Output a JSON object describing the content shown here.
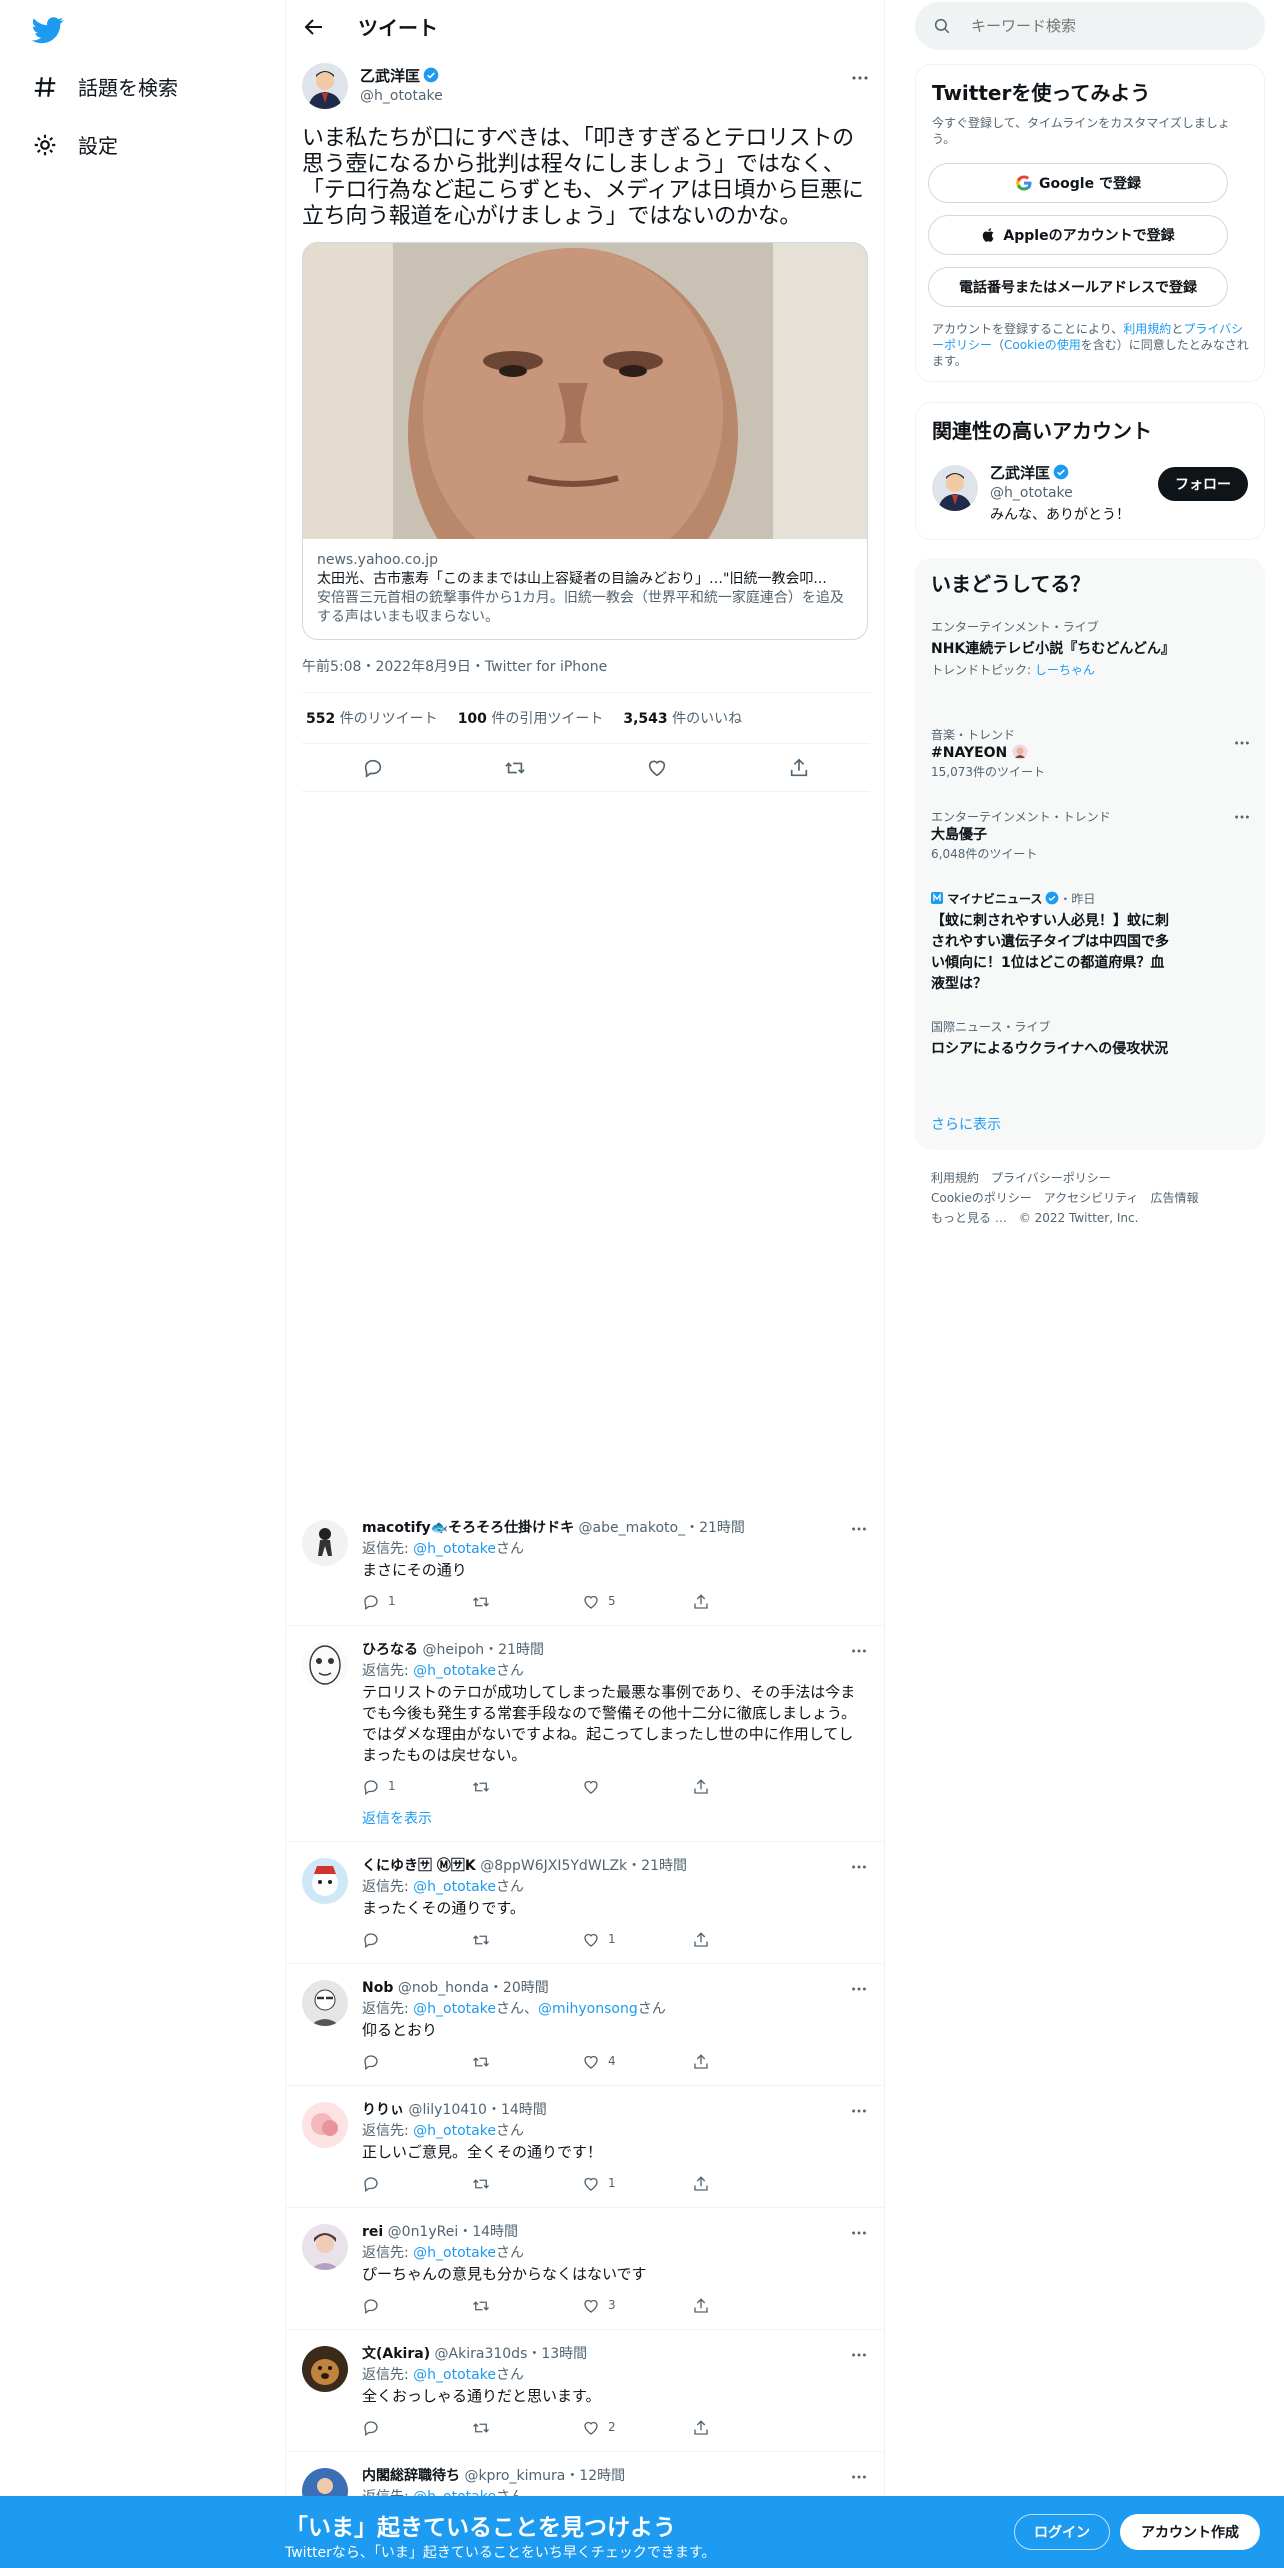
{
  "nav": {
    "explore": "話題を検索",
    "settings": "設定"
  },
  "header": {
    "title": "ツイート"
  },
  "tweet": {
    "display_name": "乙武洋匡",
    "handle": "@h_ototake",
    "text": "いま私たちが口にすべきは、「叩きすぎるとテロリストの思う壺になるから批判は程々にしましょう」ではなく、「テロ行為など起こらずとも、メディアは日頃から巨悪に立ち向う報道を心がけましょう」ではないのかな。",
    "card": {
      "domain": "news.yahoo.co.jp",
      "title": "太田光、古市憲寿「このままでは山上容疑者の目論みどおり」…\"旧統一教会叩...",
      "description": "安倍晋三元首相の銃撃事件から1カ月。旧統一教会（世界平和統一家庭連合）を追及する声はいまも収まらない。"
    },
    "meta": "午前5:08・2022年8月9日・Twitter for iPhone",
    "retweets": "552",
    "retweets_label": "件のリツイート",
    "quotes": "100",
    "quotes_label": "件の引用ツイート",
    "likes": "3,543",
    "likes_label": "件のいいね"
  },
  "replies": [
    {
      "name": "macotify🐟そろそろ仕掛けドキ",
      "handle": "@abe_makoto_",
      "time": "・21時間",
      "reply_to_prefix": "返信先: ",
      "reply_to": "@h_ototake",
      "reply_to_suffix": "さん",
      "text": "まさにその通り",
      "replies_count": "1",
      "likes_count": "5"
    },
    {
      "name": "ひろなる",
      "handle": "@heipoh",
      "time": "・21時間",
      "reply_to_prefix": "返信先: ",
      "reply_to": "@h_ototake",
      "reply_to_suffix": "さん",
      "text": "テロリストのテロが成功してしまった最悪な事例であり、その手法は今までも今後も発生する常套手段なので警備その他十二分に徹底しましょう。ではダメな理由がないですよね。起こってしまったし世の中に作用してしまったものは戻せない。",
      "replies_count": "1",
      "likes_count": "",
      "show_replies": "返信を表示"
    },
    {
      "name": "くにゆき🈂 Ⓜ🈂K",
      "handle": "@8ppW6JXI5YdWLZk",
      "time": "・21時間",
      "reply_to_prefix": "返信先: ",
      "reply_to": "@h_ototake",
      "reply_to_suffix": "さん",
      "text": "まったくその通りです。",
      "replies_count": "",
      "likes_count": "1"
    },
    {
      "name": "Nob",
      "handle": "@nob_honda",
      "time": "・20時間",
      "reply_to_prefix": "返信先: ",
      "reply_to": "@h_ototake",
      "reply_to_mid": "さん、",
      "reply_to2": "@mihyonsong",
      "reply_to_suffix": "さん",
      "text": "仰るとおり",
      "replies_count": "",
      "likes_count": "4"
    },
    {
      "name": "りりぃ",
      "handle": "@lily10410",
      "time": "・14時間",
      "reply_to_prefix": "返信先: ",
      "reply_to": "@h_ototake",
      "reply_to_suffix": "さん",
      "text": "正しいご意見。全くその通りです！",
      "replies_count": "",
      "likes_count": "1"
    },
    {
      "name": "rei",
      "handle": "@0n1yRei",
      "time": "・14時間",
      "reply_to_prefix": "返信先: ",
      "reply_to": "@h_ototake",
      "reply_to_suffix": "さん",
      "text": "ぴーちゃんの意見も分からなくはないです",
      "replies_count": "",
      "likes_count": "3"
    },
    {
      "name": "文(Akira)",
      "handle": "@Akira310ds",
      "time": "・13時間",
      "reply_to_prefix": "返信先: ",
      "reply_to": "@h_ototake",
      "reply_to_suffix": "さん",
      "text": "全くおっしゃる通りだと思います。",
      "replies_count": "",
      "likes_count": "2"
    },
    {
      "name": "内閣総辞職待ち",
      "handle": "@kpro_kimura",
      "time": "・12時間",
      "reply_to_prefix": "返信先: ",
      "reply_to": "@h_ototake",
      "reply_to_suffix": "さん",
      "text": "",
      "replies_count": "",
      "likes_count": ""
    }
  ],
  "search": {
    "placeholder": "キーワード検索"
  },
  "signup": {
    "title": "Twitterを使ってみよう",
    "subtitle": "今すぐ登録して、タイムラインをカスタマイズしましょう。",
    "google": "Google で登録",
    "apple": "Appleのアカウントで登録",
    "phone": "電話番号またはメールアドレスで登録",
    "legal_prefix": "アカウントを登録することにより、",
    "legal_terms": "利用規約",
    "legal_and": "と",
    "legal_privacy": "プライバシーポリシー",
    "legal_open": "（",
    "legal_cookie": "Cookieの使用",
    "legal_suffix": "を含む）に同意したとみなされます。"
  },
  "related": {
    "title": "関連性の高いアカウント",
    "name": "乙武洋匡",
    "handle": "@h_ototake",
    "bio": "みんな、ありがとう！",
    "follow": "フォロー"
  },
  "trends": {
    "title": "いまどうしてる？",
    "items": [
      {
        "category": "エンターテインメント・ライブ",
        "title": "NHK連続テレビ小説『ちむどんどん』",
        "sub_prefix": "トレンドトピック: ",
        "sub_link": "しーちゃん"
      },
      {
        "category": "音楽・トレンド",
        "title": "#NAYEON",
        "sub": "15,073件のツイート"
      },
      {
        "category": "エンターテインメント・トレンド",
        "title": "大島優子",
        "sub": "6,048件のツイート"
      },
      {
        "category": "マイナビニュース",
        "category_time": "・昨日",
        "title": "【蚊に刺されやすい人必見！】蚊に刺されやすい遺伝子タイプは中四国で多い傾向に！1位はどこの都道府県？血液型は？"
      },
      {
        "category": "国際ニュース・ライブ",
        "title": "ロシアによるウクライナへの侵攻状況"
      }
    ],
    "show_more": "さらに表示"
  },
  "footer": {
    "terms": "利用規約",
    "privacy": "プライバシーポリシー",
    "cookie": "Cookieのポリシー",
    "accessibility": "アクセシビリティ",
    "ads": "広告情報",
    "more": "もっと見る …",
    "copyright": "© 2022 Twitter, Inc."
  },
  "bottombar": {
    "title": "「いま」起きていることを見つけよう",
    "subtitle": "Twitterなら、「いま」起きていることをいち早くチェックできます。",
    "login": "ログイン",
    "signup": "アカウント作成"
  },
  "colors": {
    "brand": "#1d9bf0",
    "text": "#0f1419",
    "muted": "#536471"
  }
}
